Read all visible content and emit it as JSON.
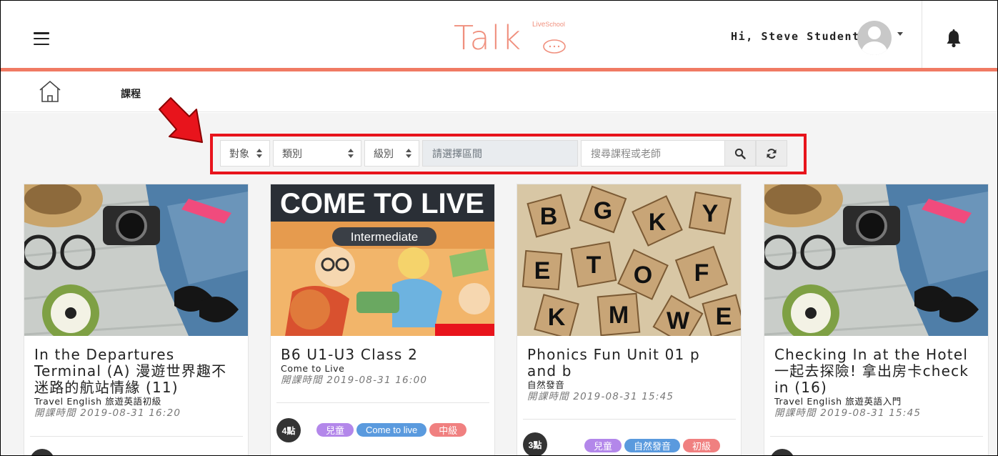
{
  "header": {
    "logo_text": "Talk",
    "logo_sub_live": "Live",
    "logo_sub_school": "School",
    "greeting": "Hi, Steve Student"
  },
  "breadcrumb": {
    "label": "課程"
  },
  "filters": {
    "audience": "對象",
    "category": "類別",
    "level": "級別",
    "range_placeholder": "請選擇區間",
    "search_placeholder": "搜尋課程或老師"
  },
  "colors": {
    "accent": "#f07a63",
    "highlight": "#e8141c",
    "tag_purple": "#b387ea",
    "tag_blue": "#5a9ade",
    "tag_red": "#f08080"
  },
  "courses": [
    {
      "title": "In the Departures Terminal (A) 漫遊世界趣不迷路的航站情緣 (11)",
      "subtitle": "Travel English 旅遊英語初級",
      "time": "開課時間 2019-08-31 16:20"
    },
    {
      "title": "B6 U1-U3 Class 2",
      "subtitle": "Come to Live",
      "time": "開課時間 2019-08-31 16:00",
      "image_banner": "COME TO LIVE",
      "image_label": "Intermediate",
      "points": "4點",
      "tags": [
        "兒童",
        "Come to live",
        "中級"
      ]
    },
    {
      "title": "Phonics Fun Unit 01 p and b",
      "subtitle": "自然發音",
      "time": "開課時間 2019-08-31 15:45",
      "points": "3點",
      "tags": [
        "兒童",
        "自然發音",
        "初級"
      ]
    },
    {
      "title": "Checking In at the Hotel 一起去探險! 拿出房卡check in (16)",
      "subtitle": "Travel English 旅遊英語入門",
      "time": "開課時間 2019-08-31 15:45"
    }
  ]
}
